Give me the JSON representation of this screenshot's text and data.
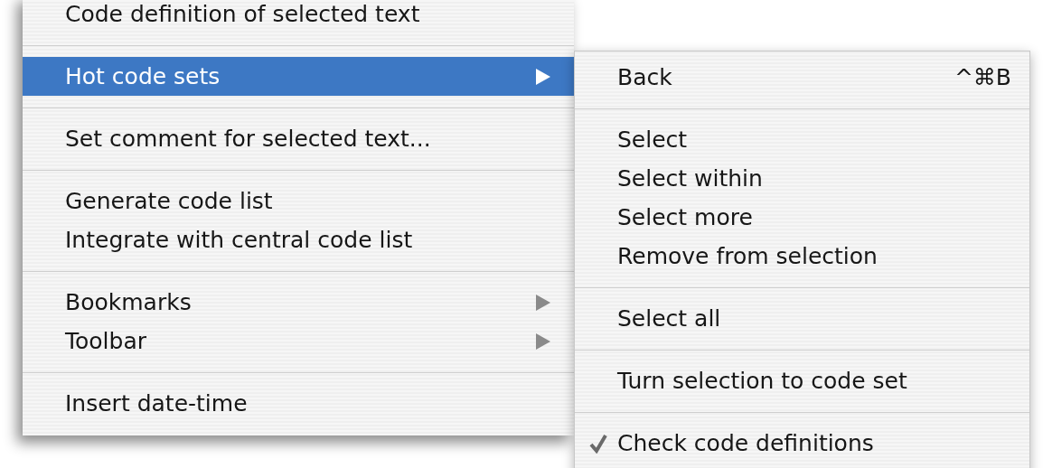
{
  "menu": {
    "items": [
      {
        "kind": "item",
        "label": "Code definition of selected text",
        "selected": false,
        "submenu": false
      },
      {
        "kind": "separator"
      },
      {
        "kind": "item",
        "label": "Hot code sets",
        "selected": true,
        "submenu": true
      },
      {
        "kind": "separator"
      },
      {
        "kind": "item",
        "label": "Set comment for selected text...",
        "selected": false,
        "submenu": false
      },
      {
        "kind": "separator"
      },
      {
        "kind": "item",
        "label": "Generate code list",
        "selected": false,
        "submenu": false
      },
      {
        "kind": "item",
        "label": "Integrate with central code list",
        "selected": false,
        "submenu": false
      },
      {
        "kind": "separator"
      },
      {
        "kind": "item",
        "label": "Bookmarks",
        "selected": false,
        "submenu": true
      },
      {
        "kind": "item",
        "label": "Toolbar",
        "selected": false,
        "submenu": true
      },
      {
        "kind": "separator"
      },
      {
        "kind": "item",
        "label": "Insert date-time",
        "selected": false,
        "submenu": false
      }
    ]
  },
  "submenu": {
    "items": [
      {
        "kind": "item",
        "label": "Back",
        "shortcut": "^⌘B",
        "checked": false
      },
      {
        "kind": "separator"
      },
      {
        "kind": "item",
        "label": "Select",
        "checked": false
      },
      {
        "kind": "item",
        "label": "Select within",
        "checked": false
      },
      {
        "kind": "item",
        "label": "Select more",
        "checked": false
      },
      {
        "kind": "item",
        "label": "Remove from selection",
        "checked": false
      },
      {
        "kind": "separator"
      },
      {
        "kind": "item",
        "label": "Select all",
        "checked": false
      },
      {
        "kind": "separator"
      },
      {
        "kind": "item",
        "label": "Turn selection to code set",
        "checked": false
      },
      {
        "kind": "separator"
      },
      {
        "kind": "item",
        "label": "Check code definitions",
        "checked": true
      }
    ]
  }
}
